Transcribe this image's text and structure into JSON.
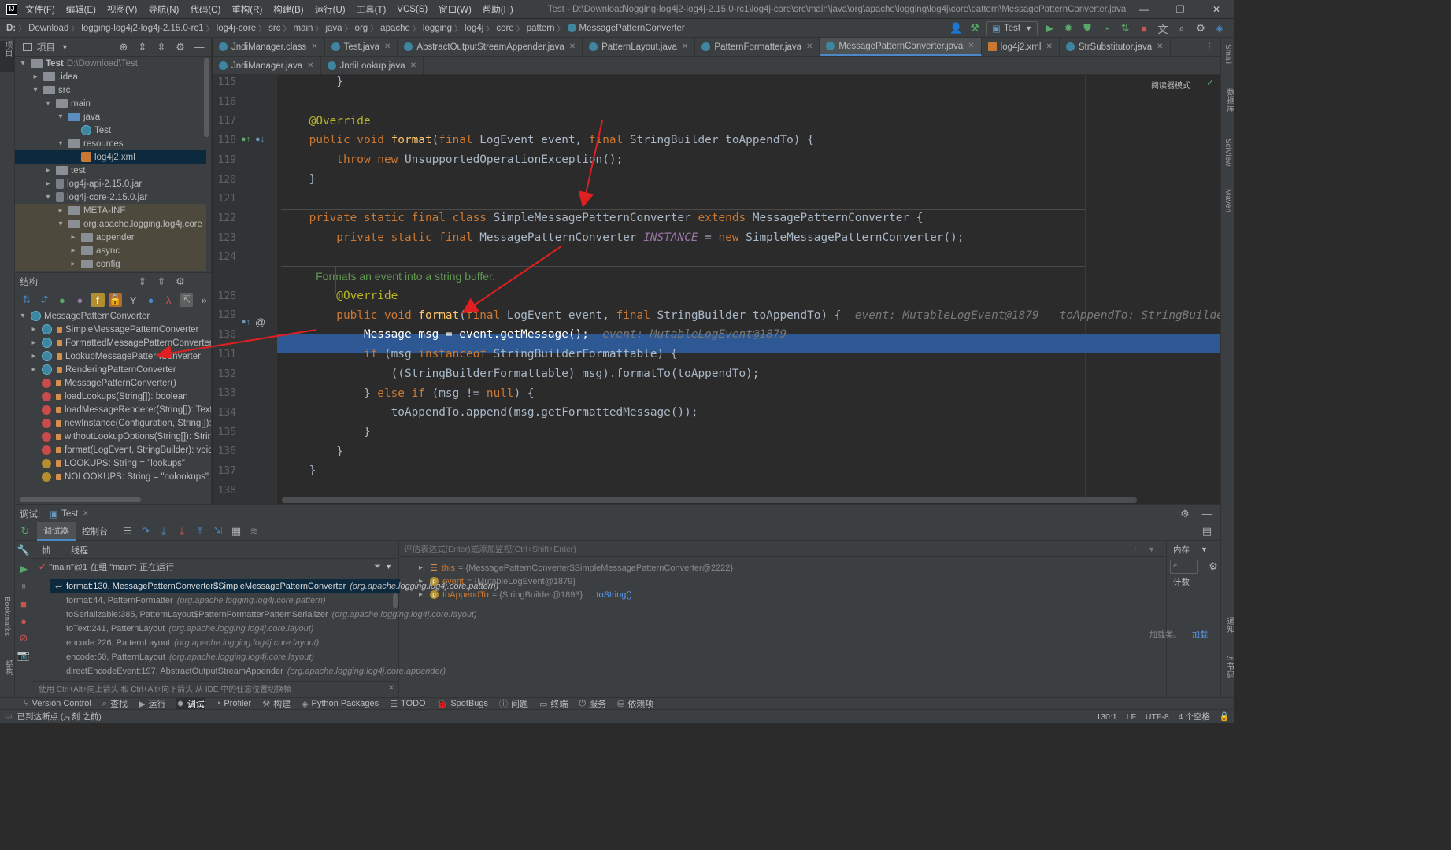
{
  "title_bar": {
    "menus": [
      "文件(F)",
      "编辑(E)",
      "视图(V)",
      "导航(N)",
      "代码(C)",
      "重构(R)",
      "构建(B)",
      "运行(U)",
      "工具(T)",
      "VCS(S)",
      "窗口(W)",
      "帮助(H)"
    ],
    "title": "Test - D:\\Download\\logging-log4j2-log4j-2.15.0-rc1\\log4j-core\\src\\main\\java\\org\\apache\\logging\\log4j\\core\\pattern\\MessagePatternConverter.java"
  },
  "breadcrumb": [
    "D:",
    "Download",
    "logging-log4j2-log4j-2.15.0-rc1",
    "log4j-core",
    "src",
    "main",
    "java",
    "org",
    "apache",
    "logging",
    "log4j",
    "core",
    "pattern",
    "MessagePatternConverter"
  ],
  "run_config": "Test",
  "project_panel": {
    "title": "项目",
    "rows": [
      {
        "label": "Test",
        "extra": "D:\\Download\\Test",
        "icon": "folder",
        "indent": 0,
        "open": true,
        "bold": true
      },
      {
        "label": ".idea",
        "icon": "folder",
        "indent": 1,
        "open": false
      },
      {
        "label": "src",
        "icon": "folder",
        "indent": 1,
        "open": true
      },
      {
        "label": "main",
        "icon": "folder",
        "indent": 2,
        "open": true
      },
      {
        "label": "java",
        "icon": "folder-blue",
        "indent": 3,
        "open": true
      },
      {
        "label": "Test",
        "icon": "class",
        "indent": 4,
        "open": null
      },
      {
        "label": "resources",
        "icon": "folder",
        "indent": 3,
        "open": true
      },
      {
        "label": "log4j2.xml",
        "icon": "xml",
        "indent": 4,
        "open": null,
        "selected": true
      },
      {
        "label": "test",
        "icon": "folder",
        "indent": 2,
        "open": false
      },
      {
        "label": "log4j-api-2.15.0.jar",
        "icon": "jar",
        "indent": 2,
        "open": false
      },
      {
        "label": "log4j-core-2.15.0.jar",
        "icon": "jar",
        "indent": 2,
        "open": true
      },
      {
        "label": "META-INF",
        "icon": "folder",
        "indent": 3,
        "open": false,
        "lib": true
      },
      {
        "label": "org.apache.logging.log4j.core",
        "icon": "folder",
        "indent": 3,
        "open": true,
        "lib": true
      },
      {
        "label": "appender",
        "icon": "folder",
        "indent": 4,
        "open": false,
        "lib": true
      },
      {
        "label": "async",
        "icon": "folder",
        "indent": 4,
        "open": false,
        "lib": true
      },
      {
        "label": "config",
        "icon": "folder",
        "indent": 4,
        "open": false,
        "lib": true
      }
    ]
  },
  "structure_panel": {
    "title": "结构",
    "rows": [
      {
        "label": "MessagePatternConverter",
        "icon": "class",
        "indent": 0,
        "open": true
      },
      {
        "label": "SimpleMessagePatternConverter",
        "icon": "class",
        "indent": 1,
        "open": false
      },
      {
        "label": "FormattedMessagePatternConverter",
        "icon": "class",
        "indent": 1,
        "open": false
      },
      {
        "label": "LookupMessagePatternConverter",
        "icon": "class",
        "indent": 1,
        "open": false
      },
      {
        "label": "RenderingPatternConverter",
        "icon": "class",
        "indent": 1,
        "open": false
      },
      {
        "label": "MessagePatternConverter()",
        "icon": "m",
        "indent": 1,
        "open": null
      },
      {
        "label": "loadLookups(String[]): boolean",
        "icon": "m",
        "indent": 1,
        "open": null
      },
      {
        "label": "loadMessageRenderer(String[]): TextRenderer",
        "icon": "m",
        "indent": 1,
        "open": null
      },
      {
        "label": "newInstance(Configuration, String[]): MessagePatternConverter",
        "icon": "m",
        "indent": 1,
        "open": null
      },
      {
        "label": "withoutLookupOptions(String[]): String[]",
        "icon": "m",
        "indent": 1,
        "open": null
      },
      {
        "label": "format(LogEvent, StringBuilder): void",
        "icon": "m",
        "indent": 1,
        "open": null
      },
      {
        "label": "LOOKUPS: String = \"lookups\"",
        "icon": "f",
        "indent": 1,
        "open": null
      },
      {
        "label": "NOLOOKUPS: String = \"nolookups\"",
        "icon": "f",
        "indent": 1,
        "open": null
      }
    ]
  },
  "editor_tabs_row1": [
    {
      "label": "JndiManager.class",
      "active": false
    },
    {
      "label": "Test.java",
      "active": false
    },
    {
      "label": "AbstractOutputStreamAppender.java",
      "active": false
    },
    {
      "label": "PatternLayout.java",
      "active": false
    },
    {
      "label": "PatternFormatter.java",
      "active": false
    },
    {
      "label": "MessagePatternConverter.java",
      "active": true
    },
    {
      "label": "log4j2.xml",
      "active": false
    },
    {
      "label": "StrSubstitutor.java",
      "active": false
    }
  ],
  "editor_tabs_row2": [
    {
      "label": "JndiManager.java",
      "active": false
    },
    {
      "label": "JndiLookup.java",
      "active": false
    }
  ],
  "reader_mode": "阅读器模式",
  "line_numbers": [
    "115",
    "116",
    "117",
    "118",
    "119",
    "120",
    "121",
    "122",
    "123",
    "124",
    "",
    "128",
    "129",
    "130",
    "131",
    "132",
    "133",
    "134",
    "135",
    "136",
    "137",
    "138"
  ],
  "code": [
    [
      {
        "t": "        }",
        "c": ""
      }
    ],
    [],
    [
      {
        "t": "    @Override",
        "c": "an"
      }
    ],
    [
      {
        "t": "    public void ",
        "c": "kw"
      },
      {
        "t": "format",
        "c": "fn"
      },
      {
        "t": "(",
        "c": ""
      },
      {
        "t": "final ",
        "c": "kw"
      },
      {
        "t": "LogEvent event, ",
        "c": ""
      },
      {
        "t": "final ",
        "c": "kw"
      },
      {
        "t": "StringBuilder toAppendTo) {",
        "c": ""
      }
    ],
    [
      {
        "t": "        throw new ",
        "c": "kw"
      },
      {
        "t": "UnsupportedOperationException();",
        "c": ""
      }
    ],
    [
      {
        "t": "    }",
        "c": ""
      }
    ],
    [],
    [
      {
        "t": "    private static final class ",
        "c": "kw"
      },
      {
        "t": "SimpleMessagePatternConverter ",
        "c": ""
      },
      {
        "t": "extends ",
        "c": "kw"
      },
      {
        "t": "MessagePatternConverter {",
        "c": ""
      }
    ],
    [
      {
        "t": "        private static final ",
        "c": "kw"
      },
      {
        "t": "MessagePatternConverter ",
        "c": ""
      },
      {
        "t": "INSTANCE",
        "c": "st"
      },
      {
        "t": " = ",
        "c": ""
      },
      {
        "t": "new ",
        "c": "kw"
      },
      {
        "t": "SimpleMessagePatternConverter();",
        "c": ""
      }
    ],
    [],
    [
      {
        "t": "        Formats an event into a string buffer.",
        "c": "cm"
      }
    ],
    [
      {
        "t": "        @Override",
        "c": "an"
      }
    ],
    [
      {
        "t": "        public void ",
        "c": "kw"
      },
      {
        "t": "format",
        "c": "fn"
      },
      {
        "t": "(",
        "c": ""
      },
      {
        "t": "final ",
        "c": "kw"
      },
      {
        "t": "LogEvent event, ",
        "c": ""
      },
      {
        "t": "final ",
        "c": "kw"
      },
      {
        "t": "StringBuilder toAppendTo) {  ",
        "c": ""
      },
      {
        "t": "event: MutableLogEvent@1879   toAppendTo: StringBuilder",
        "c": "hint"
      }
    ],
    [
      {
        "t": "            Message msg = event.getMessage();  ",
        "c": ""
      },
      {
        "t": "event: MutableLogEvent@1879",
        "c": "hint"
      }
    ],
    [
      {
        "t": "            if ",
        "c": "kw"
      },
      {
        "t": "(msg ",
        "c": ""
      },
      {
        "t": "instanceof ",
        "c": "kw"
      },
      {
        "t": "StringBuilderFormattable) {",
        "c": ""
      }
    ],
    [
      {
        "t": "                ((StringBuilderFormattable) msg).formatTo(toAppendTo);",
        "c": ""
      }
    ],
    [
      {
        "t": "            } ",
        "c": ""
      },
      {
        "t": "else if ",
        "c": "kw"
      },
      {
        "t": "(msg != ",
        "c": ""
      },
      {
        "t": "null",
        "c": "kw"
      },
      {
        "t": ") {",
        "c": ""
      }
    ],
    [
      {
        "t": "                toAppendTo.append(msg.getFormattedMessage());",
        "c": ""
      }
    ],
    [
      {
        "t": "            }",
        "c": ""
      }
    ],
    [
      {
        "t": "        }",
        "c": ""
      }
    ],
    [
      {
        "t": "    }",
        "c": ""
      }
    ],
    []
  ],
  "debug_panel": {
    "title": "调试:",
    "config": "Test",
    "tabs": [
      "调试器",
      "控制台"
    ],
    "subtabs": [
      "帧",
      "线程"
    ],
    "thread": "\"main\"@1 在组 \"main\": 正在运行",
    "frames": [
      {
        "method": "format:130, MessagePatternConverter$SimpleMessagePatternConverter",
        "pkg": "(org.apache.logging.log4j.core.pattern)",
        "active": true
      },
      {
        "method": "format:44, PatternFormatter",
        "pkg": "(org.apache.logging.log4j.core.pattern)",
        "active": false
      },
      {
        "method": "toSerializable:385, PatternLayout$PatternFormatterPatternSerializer",
        "pkg": "(org.apache.logging.log4j.core.layout)",
        "active": false
      },
      {
        "method": "toText:241, PatternLayout",
        "pkg": "(org.apache.logging.log4j.core.layout)",
        "active": false
      },
      {
        "method": "encode:226, PatternLayout",
        "pkg": "(org.apache.logging.log4j.core.layout)",
        "active": false
      },
      {
        "method": "encode:60, PatternLayout",
        "pkg": "(org.apache.logging.log4j.core.layout)",
        "active": false
      },
      {
        "method": "directEncodeEvent:197, AbstractOutputStreamAppender",
        "pkg": "(org.apache.logging.log4j.core.appender)",
        "active": false
      }
    ],
    "hint": "使用 Ctrl+Alt+向上箭头 和 Ctrl+Alt+向下箭头 从 IDE 中的任意位置切换帧",
    "eval_placeholder": "评估表达式(Enter)或添加监视(Ctrl+Shift+Enter)",
    "variables": [
      {
        "name": "this",
        "value": "= {MessagePatternConverter$SimpleMessagePatternConverter@2222}",
        "icon": "list"
      },
      {
        "name": "event",
        "value": "= {MutableLogEvent@1879}",
        "icon": "p"
      },
      {
        "name": "toAppendTo",
        "value": "= {StringBuilder@1893}",
        "link": "... toString()",
        "icon": "p"
      }
    ],
    "memory_label": "内存",
    "count_label": "计数",
    "load_text": "加载类。",
    "load_link": "加载"
  },
  "bottom_tabs": [
    "Version Control",
    "查找",
    "运行",
    "调试",
    "Profiler",
    "构建",
    "Python Packages",
    "TODO",
    "SpotBugs",
    "问题",
    "终端",
    "服务",
    "依赖项"
  ],
  "status_bar": {
    "message": "已到达断点 (片刻 之前)",
    "position": "130:1",
    "line_sep": "LF",
    "encoding": "UTF-8",
    "indent": "4 个空格"
  },
  "right_side_labels": [
    "Smali",
    "数据库",
    "SciView",
    "Maven"
  ],
  "left_side_labels": [
    "项目",
    "Bookmarks",
    "结构"
  ],
  "right_bottom_labels": [
    "通知",
    "字节码"
  ]
}
